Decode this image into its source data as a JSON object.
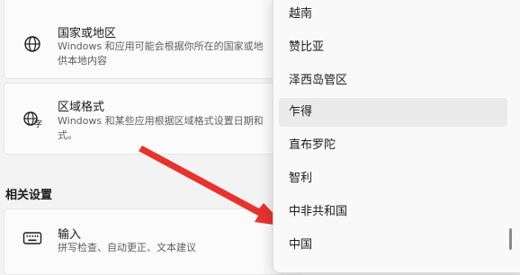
{
  "cards": [
    {
      "title": "国家或地区",
      "desc_line1": "Windows 和应用可能会根据你所在的国家或地",
      "desc_line2": "供本地内容",
      "icon": "globe-icon"
    },
    {
      "title": "区域格式",
      "desc_line1": "Windows 和某些应用根据区域格式设置日期和",
      "desc_line2": "式。",
      "icon": "region-format-icon"
    }
  ],
  "section": {
    "title": "相关设置"
  },
  "input_card": {
    "title": "输入",
    "desc": "拼写检查、自动更正、文本建议",
    "icon": "keyboard-icon"
  },
  "dropdown": {
    "options": [
      "越南",
      "赞比亚",
      "泽西岛管区",
      "乍得",
      "直布罗陀",
      "智利",
      "中非共和国",
      "中国"
    ],
    "hovered": "乍得"
  },
  "colors": {
    "arrow": "#e8322e",
    "hover": "#eaeaea"
  }
}
